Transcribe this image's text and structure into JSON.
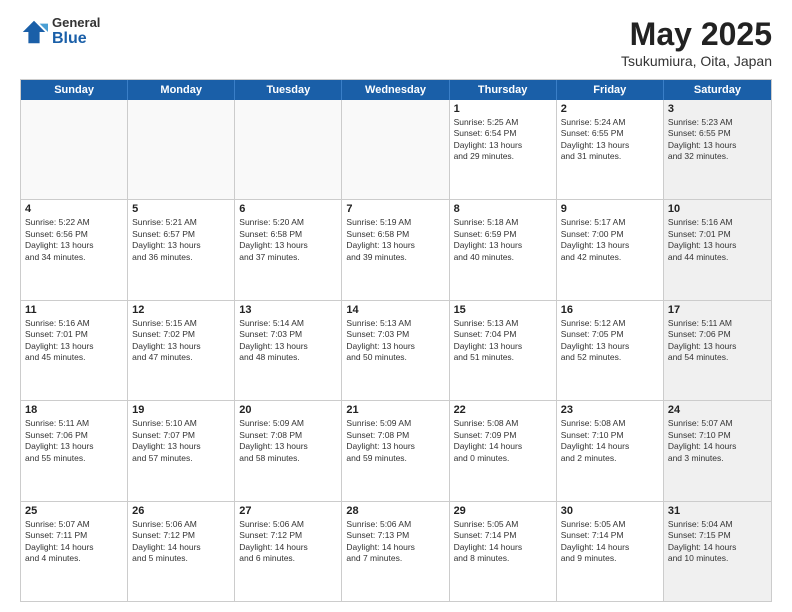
{
  "logo": {
    "general": "General",
    "blue": "Blue"
  },
  "title": {
    "month": "May 2025",
    "location": "Tsukumiura, Oita, Japan"
  },
  "days": [
    "Sunday",
    "Monday",
    "Tuesday",
    "Wednesday",
    "Thursday",
    "Friday",
    "Saturday"
  ],
  "rows": [
    [
      {
        "day": "",
        "text": "",
        "empty": true
      },
      {
        "day": "",
        "text": "",
        "empty": true
      },
      {
        "day": "",
        "text": "",
        "empty": true
      },
      {
        "day": "",
        "text": "",
        "empty": true
      },
      {
        "day": "1",
        "text": "Sunrise: 5:25 AM\nSunset: 6:54 PM\nDaylight: 13 hours\nand 29 minutes."
      },
      {
        "day": "2",
        "text": "Sunrise: 5:24 AM\nSunset: 6:55 PM\nDaylight: 13 hours\nand 31 minutes."
      },
      {
        "day": "3",
        "text": "Sunrise: 5:23 AM\nSunset: 6:55 PM\nDaylight: 13 hours\nand 32 minutes.",
        "shaded": true
      }
    ],
    [
      {
        "day": "4",
        "text": "Sunrise: 5:22 AM\nSunset: 6:56 PM\nDaylight: 13 hours\nand 34 minutes."
      },
      {
        "day": "5",
        "text": "Sunrise: 5:21 AM\nSunset: 6:57 PM\nDaylight: 13 hours\nand 36 minutes."
      },
      {
        "day": "6",
        "text": "Sunrise: 5:20 AM\nSunset: 6:58 PM\nDaylight: 13 hours\nand 37 minutes."
      },
      {
        "day": "7",
        "text": "Sunrise: 5:19 AM\nSunset: 6:58 PM\nDaylight: 13 hours\nand 39 minutes."
      },
      {
        "day": "8",
        "text": "Sunrise: 5:18 AM\nSunset: 6:59 PM\nDaylight: 13 hours\nand 40 minutes."
      },
      {
        "day": "9",
        "text": "Sunrise: 5:17 AM\nSunset: 7:00 PM\nDaylight: 13 hours\nand 42 minutes."
      },
      {
        "day": "10",
        "text": "Sunrise: 5:16 AM\nSunset: 7:01 PM\nDaylight: 13 hours\nand 44 minutes.",
        "shaded": true
      }
    ],
    [
      {
        "day": "11",
        "text": "Sunrise: 5:16 AM\nSunset: 7:01 PM\nDaylight: 13 hours\nand 45 minutes."
      },
      {
        "day": "12",
        "text": "Sunrise: 5:15 AM\nSunset: 7:02 PM\nDaylight: 13 hours\nand 47 minutes."
      },
      {
        "day": "13",
        "text": "Sunrise: 5:14 AM\nSunset: 7:03 PM\nDaylight: 13 hours\nand 48 minutes."
      },
      {
        "day": "14",
        "text": "Sunrise: 5:13 AM\nSunset: 7:03 PM\nDaylight: 13 hours\nand 50 minutes."
      },
      {
        "day": "15",
        "text": "Sunrise: 5:13 AM\nSunset: 7:04 PM\nDaylight: 13 hours\nand 51 minutes."
      },
      {
        "day": "16",
        "text": "Sunrise: 5:12 AM\nSunset: 7:05 PM\nDaylight: 13 hours\nand 52 minutes."
      },
      {
        "day": "17",
        "text": "Sunrise: 5:11 AM\nSunset: 7:06 PM\nDaylight: 13 hours\nand 54 minutes.",
        "shaded": true
      }
    ],
    [
      {
        "day": "18",
        "text": "Sunrise: 5:11 AM\nSunset: 7:06 PM\nDaylight: 13 hours\nand 55 minutes."
      },
      {
        "day": "19",
        "text": "Sunrise: 5:10 AM\nSunset: 7:07 PM\nDaylight: 13 hours\nand 57 minutes."
      },
      {
        "day": "20",
        "text": "Sunrise: 5:09 AM\nSunset: 7:08 PM\nDaylight: 13 hours\nand 58 minutes."
      },
      {
        "day": "21",
        "text": "Sunrise: 5:09 AM\nSunset: 7:08 PM\nDaylight: 13 hours\nand 59 minutes."
      },
      {
        "day": "22",
        "text": "Sunrise: 5:08 AM\nSunset: 7:09 PM\nDaylight: 14 hours\nand 0 minutes."
      },
      {
        "day": "23",
        "text": "Sunrise: 5:08 AM\nSunset: 7:10 PM\nDaylight: 14 hours\nand 2 minutes."
      },
      {
        "day": "24",
        "text": "Sunrise: 5:07 AM\nSunset: 7:10 PM\nDaylight: 14 hours\nand 3 minutes.",
        "shaded": true
      }
    ],
    [
      {
        "day": "25",
        "text": "Sunrise: 5:07 AM\nSunset: 7:11 PM\nDaylight: 14 hours\nand 4 minutes."
      },
      {
        "day": "26",
        "text": "Sunrise: 5:06 AM\nSunset: 7:12 PM\nDaylight: 14 hours\nand 5 minutes."
      },
      {
        "day": "27",
        "text": "Sunrise: 5:06 AM\nSunset: 7:12 PM\nDaylight: 14 hours\nand 6 minutes."
      },
      {
        "day": "28",
        "text": "Sunrise: 5:06 AM\nSunset: 7:13 PM\nDaylight: 14 hours\nand 7 minutes."
      },
      {
        "day": "29",
        "text": "Sunrise: 5:05 AM\nSunset: 7:14 PM\nDaylight: 14 hours\nand 8 minutes."
      },
      {
        "day": "30",
        "text": "Sunrise: 5:05 AM\nSunset: 7:14 PM\nDaylight: 14 hours\nand 9 minutes."
      },
      {
        "day": "31",
        "text": "Sunrise: 5:04 AM\nSunset: 7:15 PM\nDaylight: 14 hours\nand 10 minutes.",
        "shaded": true
      }
    ]
  ]
}
